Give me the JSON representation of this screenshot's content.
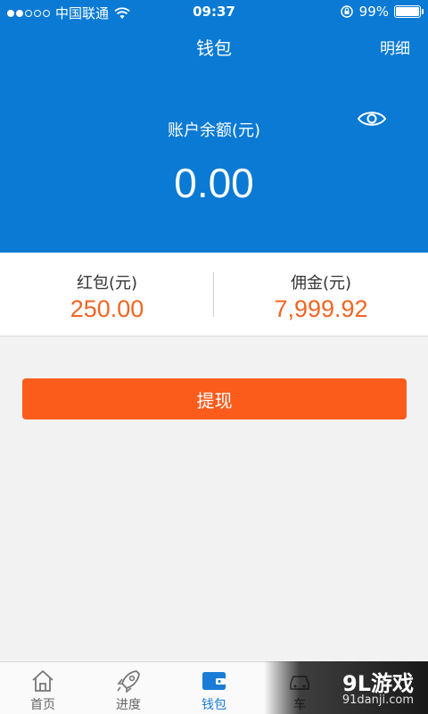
{
  "status_bar": {
    "carrier": "中国联通",
    "time": "09:37",
    "battery": "99%",
    "battery_level": 0.99,
    "signal_dots_filled": 2,
    "signal_dots_total": 5
  },
  "nav": {
    "title": "钱包",
    "action_label": "明细"
  },
  "balance": {
    "label": "账户余额(元)",
    "value": "0.00",
    "visibility_icon": "eye-icon"
  },
  "stats": [
    {
      "label": "红包(元)",
      "value": "250.00"
    },
    {
      "label": "佣金(元)",
      "value": "7,999.92"
    }
  ],
  "actions": {
    "withdraw_label": "提现"
  },
  "tabbar": {
    "items": [
      {
        "label": "首页",
        "icon": "home-icon",
        "active": false
      },
      {
        "label": "进度",
        "icon": "rocket-icon",
        "active": false
      },
      {
        "label": "钱包",
        "icon": "wallet-icon",
        "active": true
      },
      {
        "label": "车",
        "icon": "car-icon",
        "active": false
      }
    ]
  },
  "watermark": {
    "logo": "9L游戏",
    "url": "91danji.com"
  },
  "colors": {
    "header_blue": "#0a7ad4",
    "accent_orange": "#f26522",
    "button_orange": "#fb5b1b",
    "tab_active": "#1a7cd6"
  }
}
